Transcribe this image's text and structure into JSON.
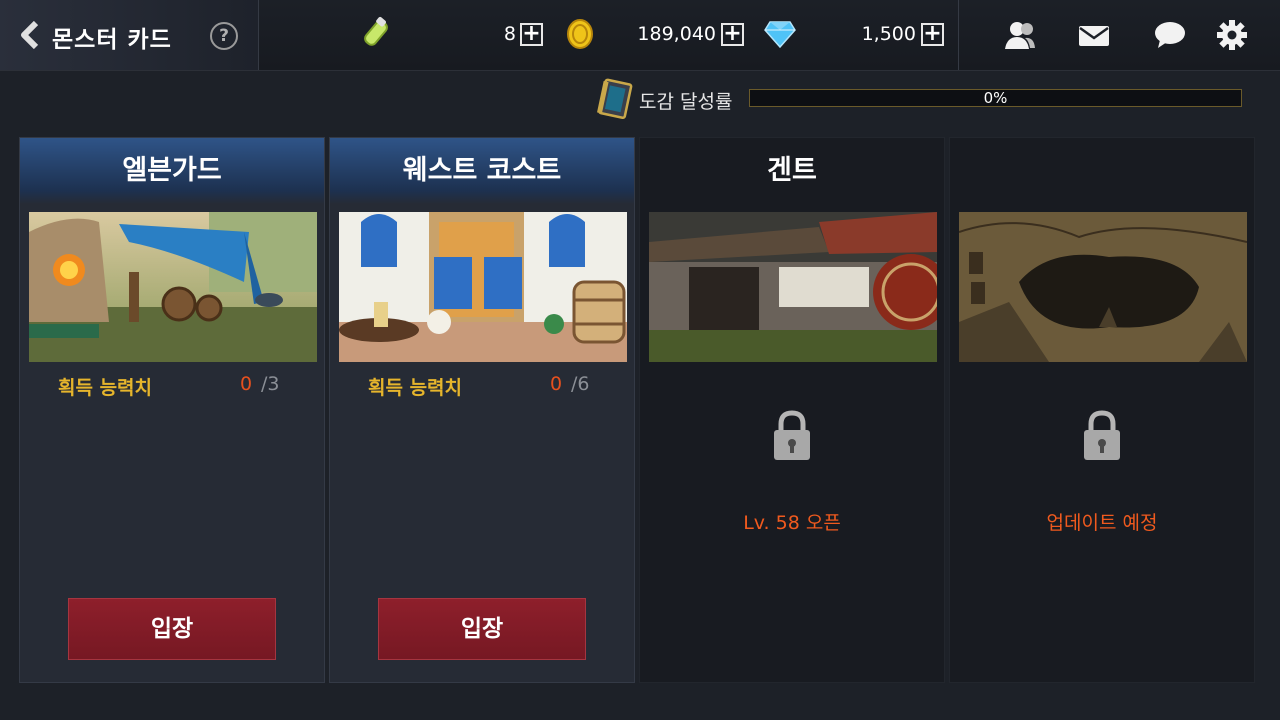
{
  "header": {
    "title": "몬스터 카드",
    "help_symbol": "?",
    "stamina": "8",
    "gold": "189,040",
    "gems": "1,500",
    "plus_symbol": "+"
  },
  "collection": {
    "label": "도감 달성률",
    "progress_text": "0%",
    "progress_fraction": 0.0
  },
  "cards": [
    {
      "title": "엘븐가드",
      "stat_label": "획득 능력치",
      "stat_current": "0",
      "stat_max": "/3",
      "button": "입장"
    },
    {
      "title": "웨스트 코스트",
      "stat_label": "획득 능력치",
      "stat_current": "0",
      "stat_max": "/6",
      "button": "입장"
    },
    {
      "title": "겐트",
      "lock_text": "Lv. 58 오픈"
    },
    {
      "lock_text": "업데이트 예정"
    }
  ],
  "colors": {
    "gold_label": "#e6b52c",
    "current_value": "#e6501e",
    "lock_text": "#f05a1e",
    "enter_button": "#8e1f2b",
    "header_blue": "#2f5488"
  },
  "icons": [
    "back-arrow-icon",
    "help-icon",
    "stamina-potion-icon",
    "gold-coin-icon",
    "gem-icon",
    "friends-icon",
    "mail-icon",
    "chat-icon",
    "settings-gear-icon",
    "collection-book-icon",
    "lock-icon"
  ]
}
